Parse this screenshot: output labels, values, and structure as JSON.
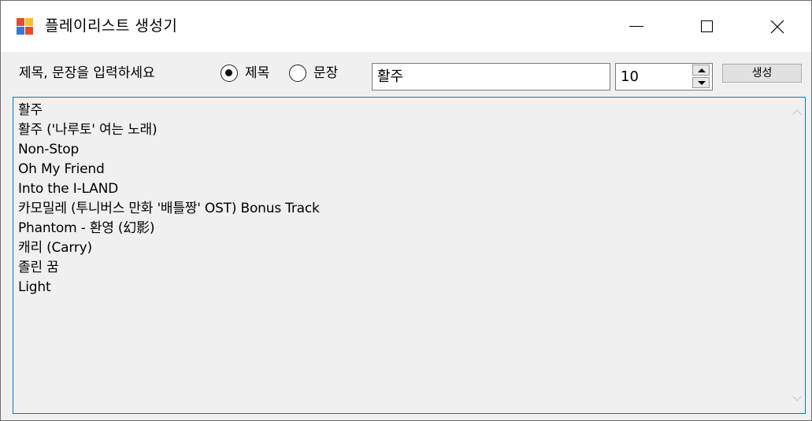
{
  "window": {
    "title": "플레이리스트 생성기",
    "icon": "app-icon",
    "controls": {
      "minimize": "minimize-icon",
      "maximize": "maximize-icon",
      "close": "close-icon"
    }
  },
  "form": {
    "prompt": "제목, 문장을 입력하세요",
    "radio_title_label": "제목",
    "radio_sentence_label": "문장",
    "selected_mode": "제목",
    "query_value": "활주",
    "count_value": "10",
    "generate_label": "생성"
  },
  "results": [
    "활주",
    "활주 ('나루토' 여는 노래)",
    "Non-Stop",
    "Oh My Friend",
    "Into the I-LAND",
    "카모밀레 (투니버스 만화 '배틀짱' OST) Bonus Track",
    "Phantom - 환영 (幻影)",
    "캐리 (Carry)",
    "졸린 꿈",
    "Light"
  ],
  "colors": {
    "focus_border": "#0078d7",
    "window_bg": "#f0f0f0"
  }
}
